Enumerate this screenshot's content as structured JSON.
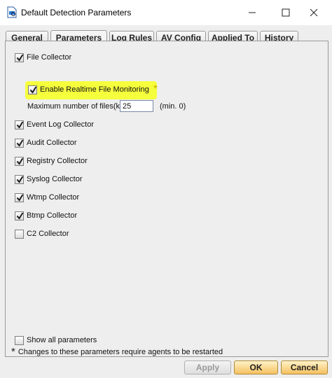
{
  "window": {
    "title": "Default Detection Parameters",
    "minimize_glyph": "—",
    "maximize_glyph": "☐",
    "close_glyph": "✕"
  },
  "tabs": [
    {
      "label": "General",
      "active": false
    },
    {
      "label": "Parameters",
      "active": true
    },
    {
      "label": "Log Rules",
      "active": false
    },
    {
      "label": "AV Config",
      "active": false
    },
    {
      "label": "Applied To",
      "active": false
    },
    {
      "label": "History",
      "active": false
    }
  ],
  "parameters": {
    "file_collector": {
      "label": "File Collector",
      "checked": true
    },
    "realtime_monitoring": {
      "label": "Enable Realtime File Monitoring",
      "checked": true,
      "marker": "*"
    },
    "max_files": {
      "label": "Maximum number of files(k):",
      "value": "25",
      "hint": "(min. 0)"
    },
    "collectors": [
      {
        "label": "Event Log Collector",
        "checked": true
      },
      {
        "label": "Audit Collector",
        "checked": true
      },
      {
        "label": "Registry Collector",
        "checked": true
      },
      {
        "label": "Syslog Collector",
        "checked": true
      },
      {
        "label": "Wtmp Collector",
        "checked": true
      },
      {
        "label": "Btmp Collector",
        "checked": true
      },
      {
        "label": "C2 Collector",
        "checked": false
      }
    ],
    "show_all": {
      "label": "Show all parameters",
      "checked": false
    },
    "note": {
      "marker": "*",
      "text": "Changes to these parameters require agents to be restarted"
    }
  },
  "buttons": {
    "apply": "Apply",
    "ok": "OK",
    "cancel": "Cancel"
  },
  "colors": {
    "highlight": "#f6ff3c",
    "primary_button": "#f5c060"
  }
}
